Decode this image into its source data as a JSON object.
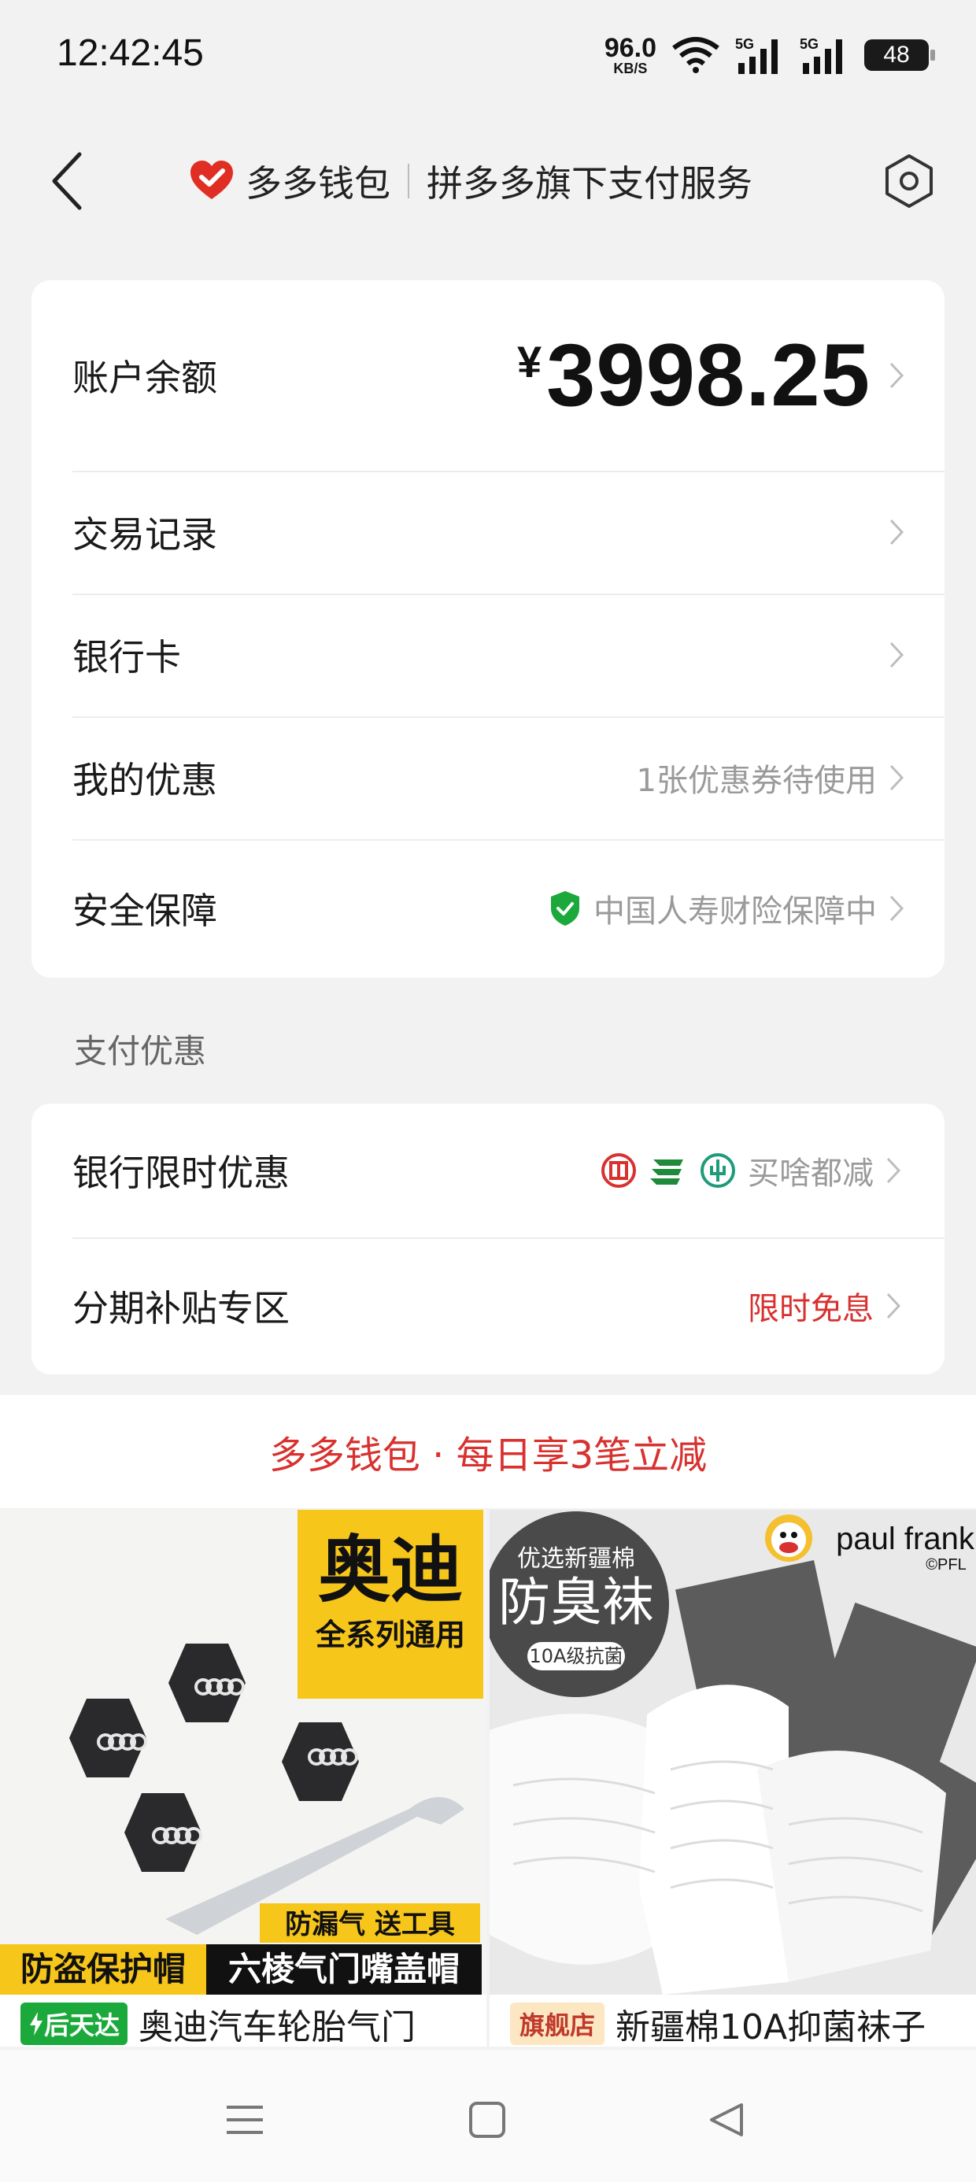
{
  "status_bar": {
    "time": "12:42:45",
    "net_speed_value": "96.0",
    "net_speed_unit": "KB/S",
    "wifi_label": "5",
    "sim1_label": "5G",
    "sim2_label": "5G",
    "battery": "48"
  },
  "nav": {
    "brand": "多多钱包",
    "subtitle": "拼多多旗下支付服务",
    "brand_color": "#e02e24"
  },
  "account_card": {
    "balance_label": "账户余额",
    "currency_symbol": "¥",
    "balance_value": "3998.25",
    "rows": [
      {
        "label": "交易记录",
        "right_text": ""
      },
      {
        "label": "银行卡",
        "right_text": ""
      },
      {
        "label": "我的优惠",
        "right_text": "1张优惠券待使用"
      },
      {
        "label": "安全保障",
        "right_text": "中国人寿财险保障中"
      }
    ]
  },
  "payment_section": {
    "title": "支付优惠",
    "rows": [
      {
        "label": "银行限时优惠",
        "right_text": "买啥都减",
        "bank_icons": [
          "icbc-bank-icon",
          "postal-bank-icon",
          "agricultural-bank-icon"
        ]
      },
      {
        "label": "分期补贴专区",
        "right_text": "限时免息",
        "right_color": "#d8312f"
      }
    ]
  },
  "promo_banner": {
    "text": "多多钱包 · 每日享3笔立减"
  },
  "products": [
    {
      "image_text_top": "奥迪",
      "image_text_sub": "全系列通用",
      "image_text_tag1": "防漏气 送工具",
      "image_text_tag2": "防盗保护帽",
      "image_text_tag3": "六棱气门嘴盖帽",
      "badge": "后天达",
      "title": "奥迪汽车轮胎气门"
    },
    {
      "image_text_circle1": "优选新疆棉",
      "image_text_circle2": "防臭袜",
      "image_text_circle3": "10A级抗菌",
      "image_brand": "paul frank",
      "image_brand_sub": "©PFL",
      "badge": "旗舰店",
      "title": "新疆棉10A抑菌袜子"
    }
  ],
  "system_nav": [
    "menu-icon",
    "home-icon",
    "back-icon"
  ]
}
